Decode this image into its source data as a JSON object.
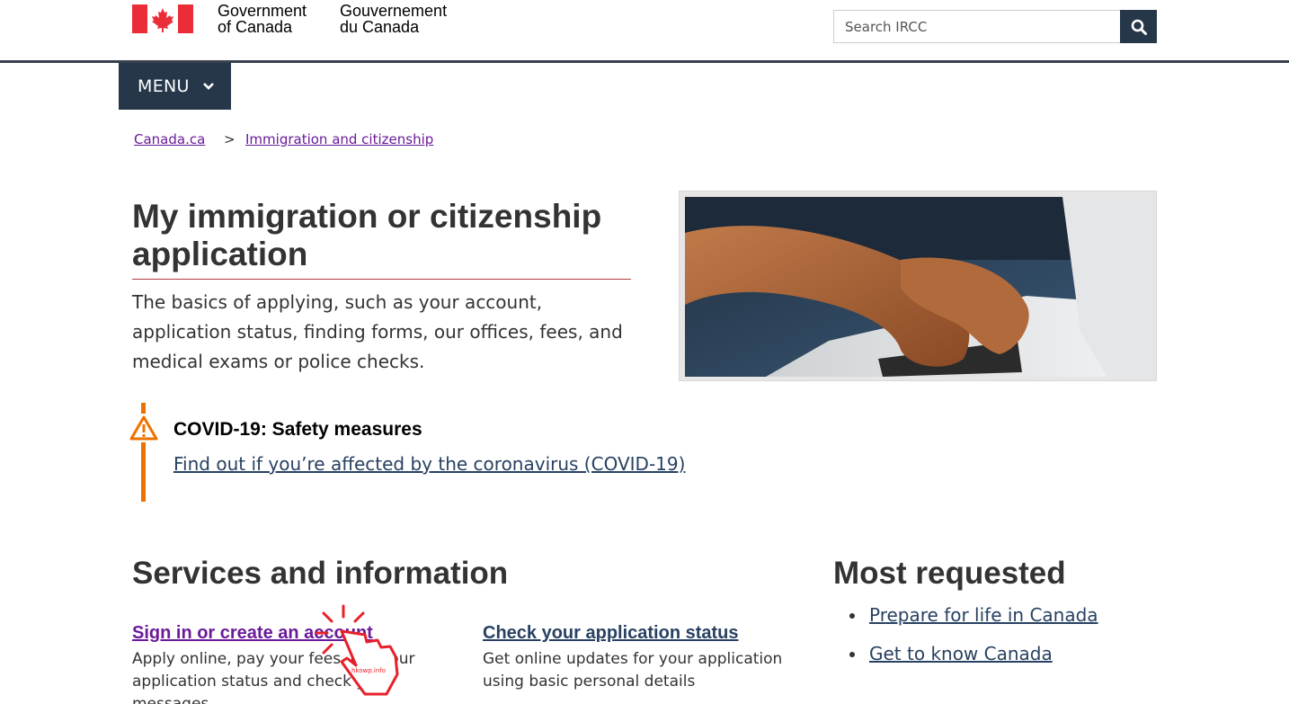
{
  "header": {
    "signature_en_line1": "Government",
    "signature_en_line2": "of Canada",
    "signature_fr_line1": "Gouvernement",
    "signature_fr_line2": "du Canada",
    "search_placeholder": "Search IRCC",
    "search_icon": "search-icon"
  },
  "menu": {
    "label": "MENU",
    "icon": "chevron-down-icon"
  },
  "breadcrumb": {
    "items": [
      "Canada.ca",
      "Immigration and citizenship"
    ],
    "separator": ">"
  },
  "page": {
    "title": "My immigration or citizenship application",
    "intro": "The basics of applying, such as your account, application status, finding forms, our offices, fees, and medical exams or police checks."
  },
  "alert": {
    "icon": "warning-icon",
    "title": "COVID-19: Safety measures",
    "link": "Find out if you’re affected by the coronavirus (COVID-19)"
  },
  "services": {
    "heading": "Services and information",
    "items": [
      {
        "title": "Sign in or create an account",
        "description": "Apply online, pay your fees, get your application status and check your messages"
      },
      {
        "title": "Check your application status",
        "description": "Get online updates for your application using basic personal details"
      }
    ]
  },
  "most_requested": {
    "heading": "Most requested",
    "items": [
      "Prepare for life in Canada",
      "Get to know Canada"
    ]
  },
  "overlay": {
    "watermark": "hkowp.info"
  },
  "colors": {
    "navy": "#26374a",
    "link": "#284162",
    "visited": "#6a1b9a",
    "alert": "#ee7100",
    "rule": "#af3c43"
  }
}
